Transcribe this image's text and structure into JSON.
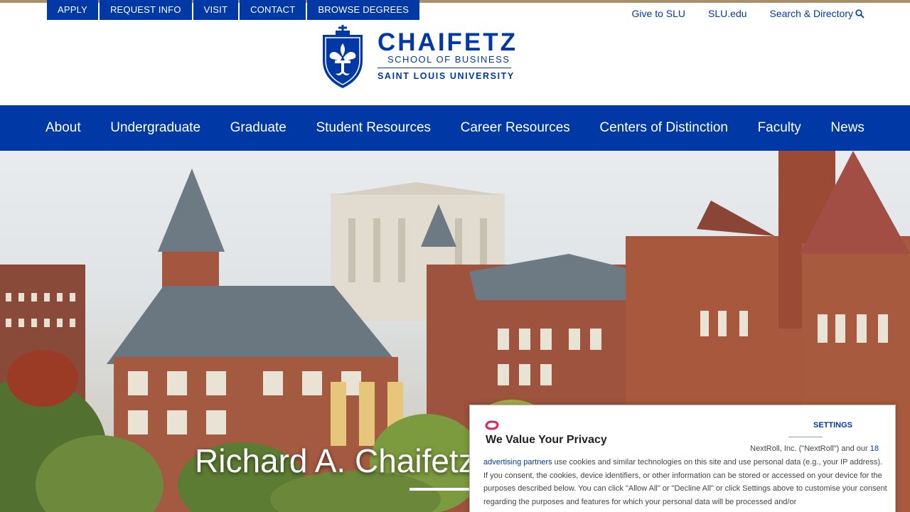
{
  "utility_nav": [
    "APPLY",
    "REQUEST INFO",
    "VISIT",
    "CONTACT",
    "BROWSE DEGREES"
  ],
  "top_links": {
    "give": "Give to SLU",
    "slu": "SLU.edu",
    "search": "Search & Directory"
  },
  "logo": {
    "name": "CHAIFETZ",
    "school": "SCHOOL OF BUSINESS",
    "university": "SAINT LOUIS UNIVERSITY"
  },
  "main_nav": [
    "About",
    "Undergraduate",
    "Graduate",
    "Student Resources",
    "Career Resources",
    "Centers of Distinction",
    "Faculty",
    "News"
  ],
  "hero": {
    "title": "Richard A. Chaifetz"
  },
  "privacy": {
    "title": "We Value Your Privacy",
    "settings": "SETTINGS",
    "body_lead": "NextRoll, Inc. (\"NextRoll\") and our ",
    "link_number": "18",
    "link_text": "advertising partners",
    "body_rest": " use cookies and similar technologies on this site and use personal data (e.g., your IP address). If you consent, the cookies, device identifiers, or other information can be stored or accessed on your device for the purposes described below. You can click \"Allow All\" or \"Decline All\" or click Settings above to customise your consent regarding the purposes and features for which your personal data will be processed and/or"
  },
  "colors": {
    "brand_blue": "#0039a6",
    "gold": "#a8916a",
    "nextroll_red": "#e0245e"
  }
}
